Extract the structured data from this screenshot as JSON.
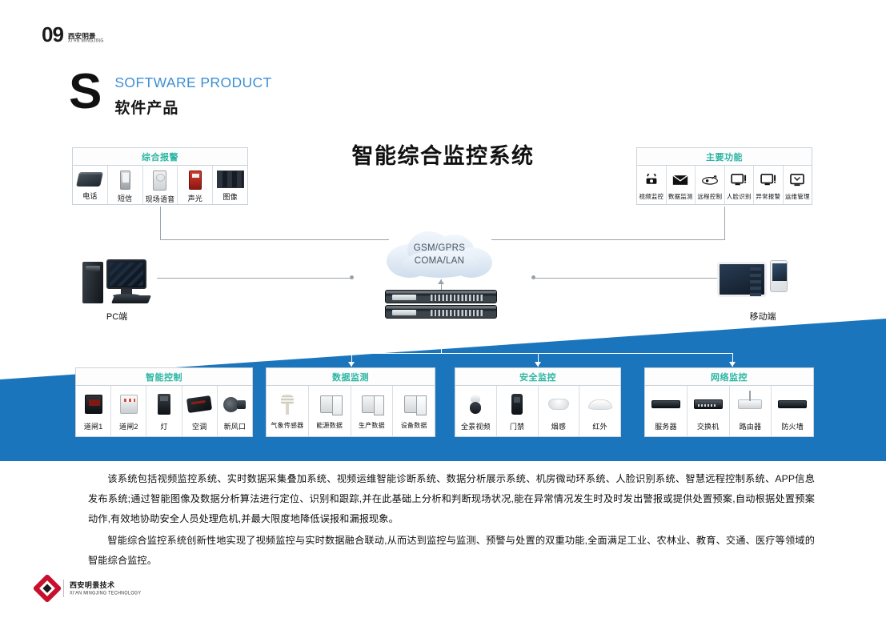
{
  "page_mark": {
    "number": "09",
    "brand_cn": "西安明景",
    "brand_en": "XI'AN MINGJING"
  },
  "section": {
    "letter": "S",
    "title_en": "SOFTWARE PRODUCT",
    "title_cn": "软件产品",
    "accent": "#3d8fd4"
  },
  "main_title": "智能综合监控系统",
  "cloud": {
    "line1": "GSM/GPRS",
    "line2": "COMA/LAN"
  },
  "endpoints": {
    "pc_label": "PC端",
    "mobile_label": "移动端"
  },
  "panels": {
    "alarm": {
      "title": "综合报警",
      "items": [
        {
          "label": "电话",
          "icon": "telephone-icon"
        },
        {
          "label": "短信",
          "icon": "sms-icon"
        },
        {
          "label": "现场语音",
          "icon": "intercom-icon"
        },
        {
          "label": "声光",
          "icon": "siren-icon"
        },
        {
          "label": "图像",
          "icon": "video-wall-icon"
        }
      ]
    },
    "functions": {
      "title": "主要功能",
      "items": [
        {
          "label": "视频监控",
          "icon": "cctv-icon"
        },
        {
          "label": "数据监测",
          "icon": "envelope-icon"
        },
        {
          "label": "远程控制",
          "icon": "remote-control-icon"
        },
        {
          "label": "人脸识别",
          "icon": "face-recognition-icon"
        },
        {
          "label": "异常报警",
          "icon": "alert-monitor-icon"
        },
        {
          "label": "运维管理",
          "icon": "maintenance-icon"
        }
      ]
    },
    "smart_control": {
      "title": "智能控制",
      "items": [
        {
          "label": "道闸1",
          "icon": "barrier-gate-1-icon"
        },
        {
          "label": "道闸2",
          "icon": "barrier-gate-2-icon"
        },
        {
          "label": "灯",
          "icon": "lamp-icon"
        },
        {
          "label": "空调",
          "icon": "air-conditioner-icon"
        },
        {
          "label": "新风口",
          "icon": "fresh-air-vent-icon"
        }
      ]
    },
    "data_monitor": {
      "title": "数据监测",
      "items": [
        {
          "label": "气象传感器",
          "icon": "weather-sensor-icon"
        },
        {
          "label": "能源数据",
          "icon": "energy-cabinet-icon"
        },
        {
          "label": "生产数据",
          "icon": "production-cabinet-icon"
        },
        {
          "label": "设备数据",
          "icon": "equipment-cabinet-icon"
        }
      ]
    },
    "security": {
      "title": "安全监控",
      "items": [
        {
          "label": "全景视频",
          "icon": "ptz-camera-icon"
        },
        {
          "label": "门禁",
          "icon": "access-control-icon"
        },
        {
          "label": "烟感",
          "icon": "smoke-detector-icon"
        },
        {
          "label": "红外",
          "icon": "infrared-detector-icon"
        }
      ]
    },
    "network": {
      "title": "网络监控",
      "items": [
        {
          "label": "服务器",
          "icon": "server-icon"
        },
        {
          "label": "交换机",
          "icon": "switch-icon"
        },
        {
          "label": "路由器",
          "icon": "router-icon"
        },
        {
          "label": "防火墙",
          "icon": "firewall-icon"
        }
      ]
    }
  },
  "body": {
    "p1": "该系统包括视频监控系统、实时数据采集叠加系统、视频运维智能诊断系统、数据分析展示系统、机房微动环系统、人脸识别系统、智慧远程控制系统、APP信息发布系统;通过智能图像及数据分析算法进行定位、识别和跟踪,并在此基础上分析和判断现场状况,能在异常情况发生时及时发出警报或提供处置预案,自动根据处置预案动作,有效地协助安全人员处理危机,并最大限度地降低误报和漏报现象。",
    "p2": "智能综合监控系统创新性地实现了视频监控与实时数据融合联动,从而达到监控与监测、预警与处置的双重功能,全面满足工业、农林业、教育、交通、医疗等领域的智能综合监控。"
  },
  "footer": {
    "cn": "西安明景技术",
    "en": "XI'AN MINGJING TECHNOLOGY"
  },
  "colors": {
    "banner_blue": "#1b75bc",
    "panel_title": "#2bb6a3",
    "accent_blue": "#3d8fd4"
  }
}
